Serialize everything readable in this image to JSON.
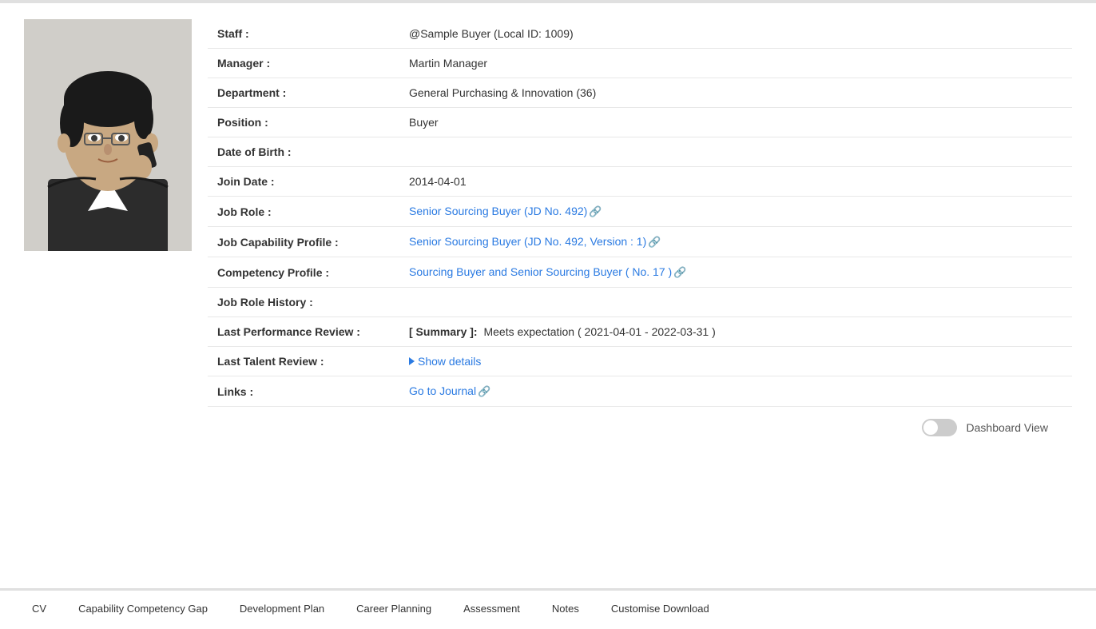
{
  "profile": {
    "staff_label": "Staff :",
    "staff_value": "@Sample Buyer (Local ID: 1009)",
    "manager_label": "Manager :",
    "manager_value": "Martin Manager",
    "department_label": "Department :",
    "department_value": "General Purchasing & Innovation (36)",
    "position_label": "Position :",
    "position_value": "Buyer",
    "dob_label": "Date of Birth :",
    "dob_value": "",
    "join_date_label": "Join Date :",
    "join_date_value": "2014-04-01",
    "job_role_label": "Job Role :",
    "job_role_value": "Senior Sourcing Buyer (JD No. 492)",
    "job_cap_label": "Job Capability Profile :",
    "job_cap_value": "Senior Sourcing Buyer (JD No. 492, Version : 1)",
    "competency_label": "Competency Profile :",
    "competency_value": "Sourcing Buyer and Senior Sourcing Buyer ( No. 17 )",
    "job_role_history_label": "Job Role History :",
    "job_role_history_value": "",
    "last_perf_label": "Last Performance Review :",
    "summary_bracket": "[ Summary ]:",
    "summary_value": "Meets expectation ( 2021-04-01 - 2022-03-31 )",
    "talent_review_label": "Last Talent Review :",
    "show_details_label": "Show details",
    "links_label": "Links :",
    "go_to_journal": "Go to Journal",
    "dashboard_view_label": "Dashboard View"
  },
  "bottom_nav": {
    "items": [
      {
        "label": "CV",
        "active": false
      },
      {
        "label": "Capability Competency Gap",
        "active": false
      },
      {
        "label": "Development Plan",
        "active": false
      },
      {
        "label": "Career Planning",
        "active": false
      },
      {
        "label": "Assessment",
        "active": false
      },
      {
        "label": "Notes",
        "active": false
      },
      {
        "label": "Customise Download",
        "active": false
      }
    ]
  }
}
